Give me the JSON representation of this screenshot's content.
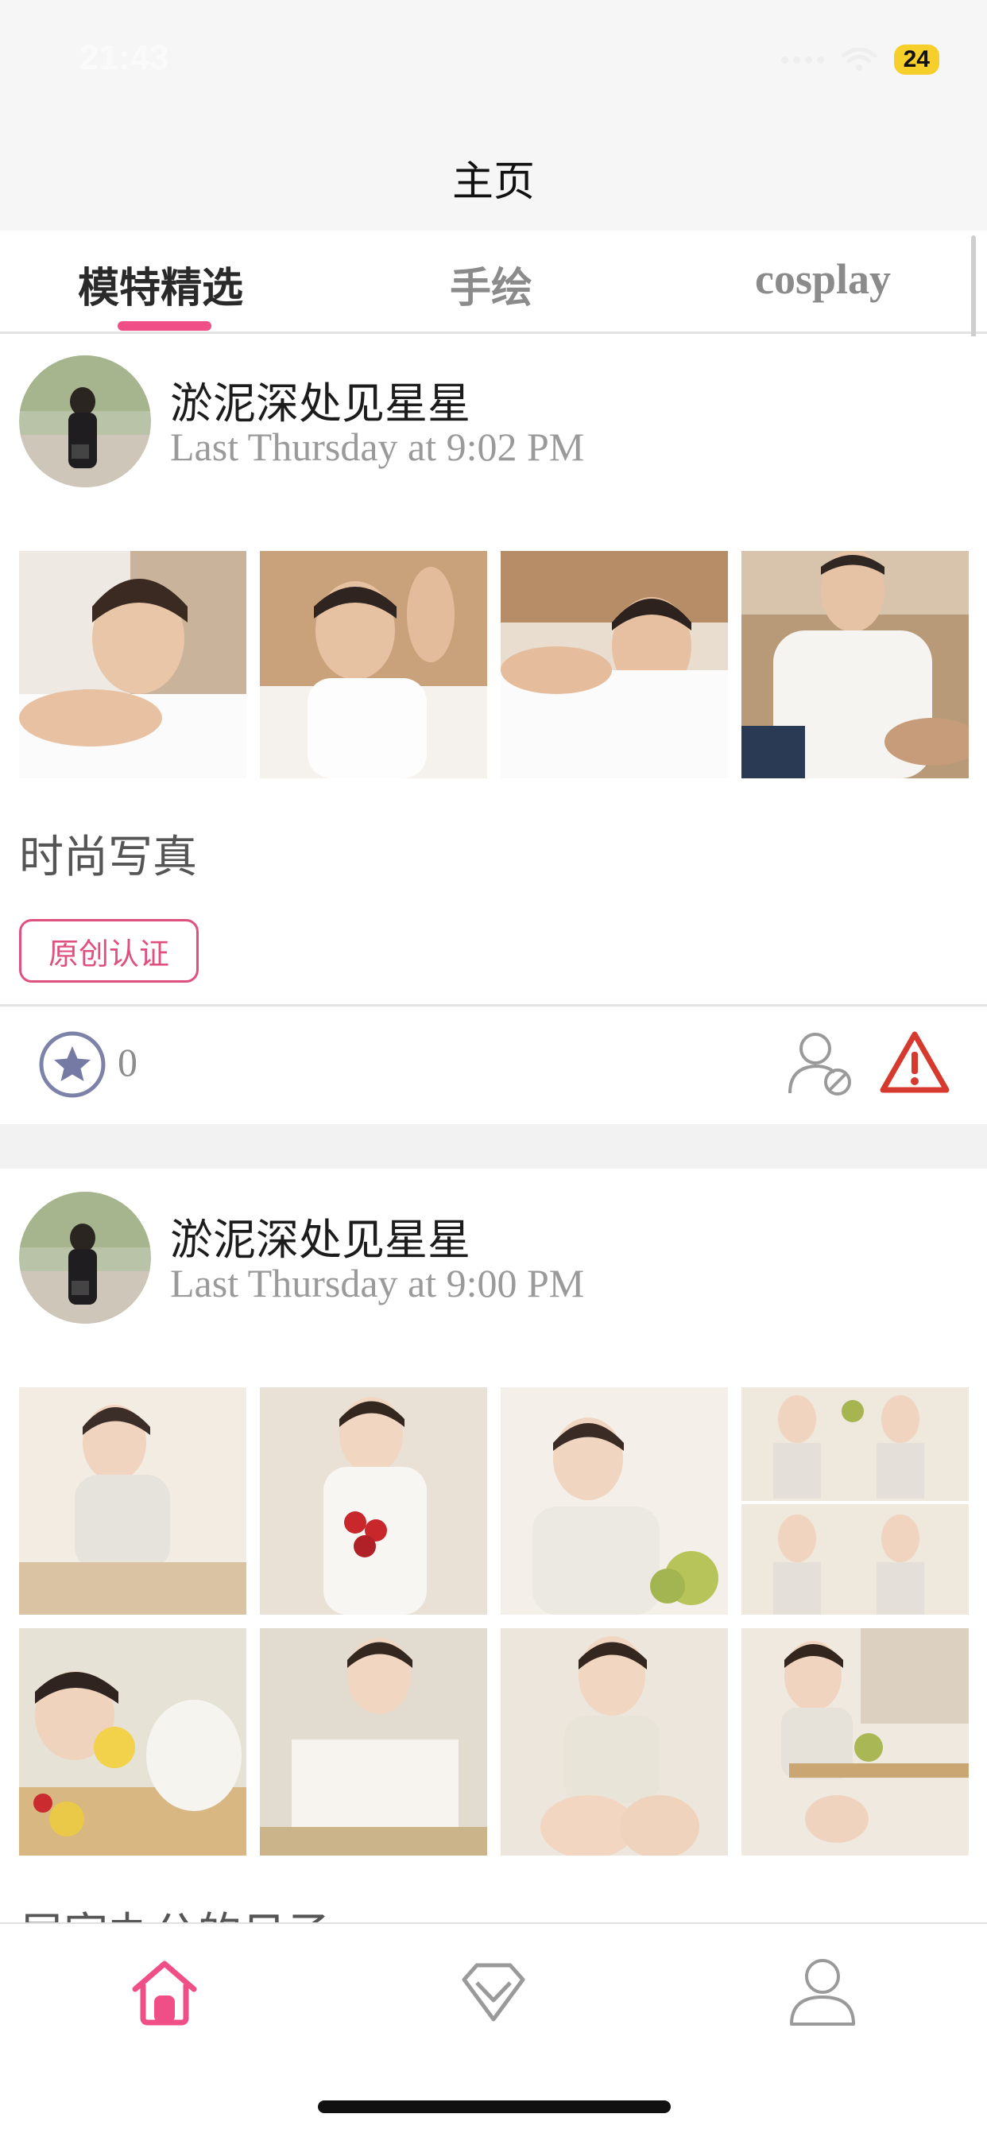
{
  "status_bar": {
    "time": "21:43",
    "battery": "24"
  },
  "nav": {
    "title": "主页"
  },
  "tabs": [
    {
      "label": "模特精选",
      "active": true
    },
    {
      "label": "手绘",
      "active": false
    },
    {
      "label": "cosplay",
      "active": false
    }
  ],
  "posts": [
    {
      "username": "淤泥深处见星星",
      "time": "Last Thursday at 9:02 PM",
      "caption": "时尚写真",
      "badge": "原创认证",
      "star_count": "0",
      "image_count": 4
    },
    {
      "username": "淤泥深处见星星",
      "time": "Last Thursday at 9:00 PM",
      "caption": "居家办公的日子",
      "image_count": 8
    }
  ],
  "bottom_tabs": [
    {
      "icon": "home-icon",
      "active": true
    },
    {
      "icon": "diamond-icon",
      "active": false
    },
    {
      "icon": "person-icon",
      "active": false
    }
  ],
  "colors": {
    "accent": "#ef4f86",
    "warning": "#d63a2f",
    "muted": "#8d8d8d"
  }
}
